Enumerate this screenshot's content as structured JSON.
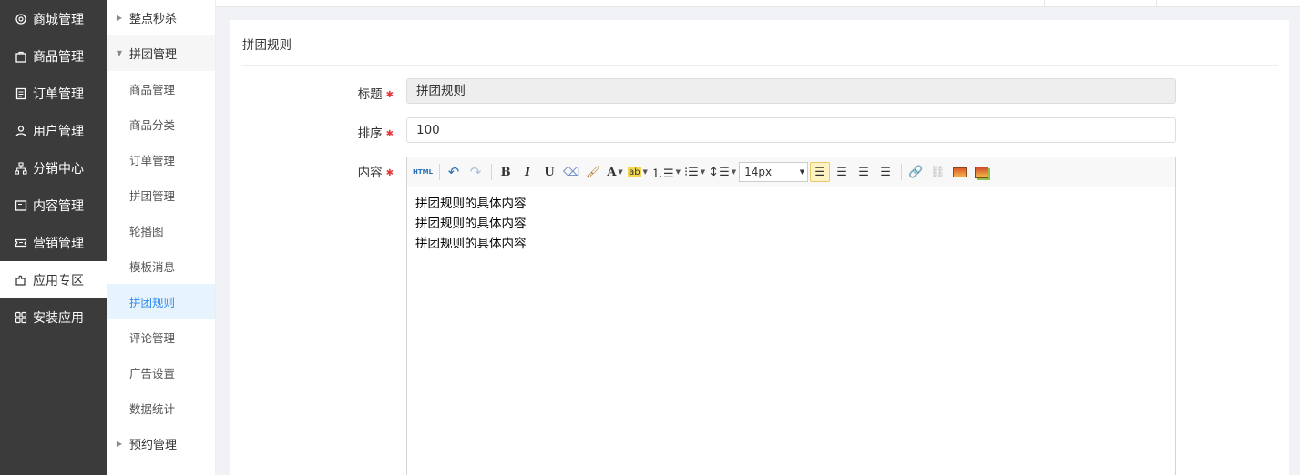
{
  "nav_primary": [
    {
      "label": "商城管理",
      "icon": "gear-icon"
    },
    {
      "label": "商品管理",
      "icon": "bag-icon"
    },
    {
      "label": "订单管理",
      "icon": "document-icon"
    },
    {
      "label": "用户管理",
      "icon": "user-icon"
    },
    {
      "label": "分销中心",
      "icon": "hierarchy-icon"
    },
    {
      "label": "内容管理",
      "icon": "article-icon"
    },
    {
      "label": "营销管理",
      "icon": "ticket-icon"
    },
    {
      "label": "应用专区",
      "icon": "puzzle-icon",
      "active": true
    },
    {
      "label": "安装应用",
      "icon": "grid-icon"
    }
  ],
  "nav_secondary": {
    "group_flash": "整点秒杀",
    "group_group": "拼团管理",
    "items": [
      "商品管理",
      "商品分类",
      "订单管理",
      "拼团管理",
      "轮播图",
      "模板消息",
      "拼团规则",
      "评论管理",
      "广告设置",
      "数据统计"
    ],
    "active_item": "拼团规则",
    "group_booking": "预约管理"
  },
  "panel": {
    "title": "拼团规则",
    "form": {
      "title_label": "标题",
      "title_value": "拼团规则",
      "sort_label": "排序",
      "sort_value": "100",
      "content_label": "内容"
    }
  },
  "editor": {
    "html_label": "HTML",
    "font_size": "14px",
    "content_lines": [
      "拼团规则的具体内容",
      "拼团规则的具体内容",
      "拼团规则的具体内容"
    ]
  },
  "colors": {
    "sidebar_bg": "#3b3b3b",
    "active_blue": "#2d8cf0",
    "required_red": "#e4393c"
  }
}
